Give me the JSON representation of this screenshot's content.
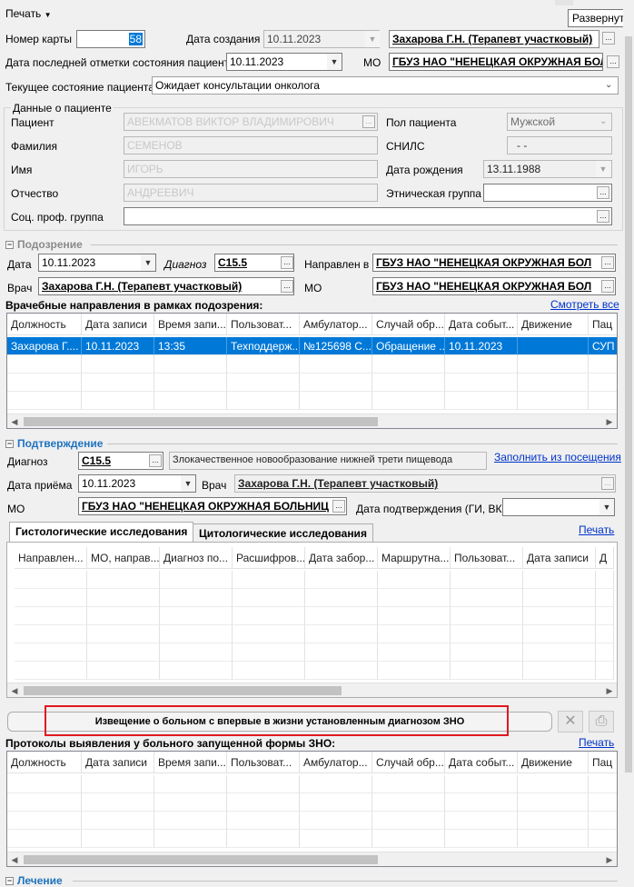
{
  "toolbar": {
    "print_menu": "Печать",
    "expand_tooltip": "Развернуть"
  },
  "header": {
    "card_number_label": "Номер карты",
    "card_number_value": "58",
    "created_label": "Дата создания",
    "created_value": "10.11.2023",
    "doctor_value": "Захарова Г.Н. (Терапевт участковый)",
    "last_mark_label": "Дата последней отметки состояния пациента",
    "last_mark_value": "10.11.2023",
    "mo_label": "МО",
    "mo_value": "ГБУЗ НАО \"НЕНЕЦКАЯ ОКРУЖНАЯ БОЛ",
    "state_label": "Текущее состояние пациента",
    "state_value": "Ожидает консультации онколога"
  },
  "patient": {
    "group_title": "Данные о пациенте",
    "patient_label": "Пациент",
    "patient_value": "АВЕКМАТОВ ВИКТОР ВЛАДИМИРОВИЧ",
    "surname_label": "Фамилия",
    "surname_value": "СЕМЕНОВ",
    "name_label": "Имя",
    "name_value": "ИГОРЬ",
    "patronymic_label": "Отчество",
    "patronymic_value": "АНДРЕЕВИЧ",
    "social_label": "Соц. проф. группа",
    "social_value": "",
    "sex_label": "Пол пациента",
    "sex_value": "Мужской",
    "snils_label": "СНИЛС",
    "snils_value": "-   -",
    "birth_label": "Дата рождения",
    "birth_value": "13.11.1988",
    "ethnic_label": "Этническая группа",
    "ethnic_value": ""
  },
  "suspicion": {
    "title": "Подозрение",
    "date_label": "Дата",
    "date_value": "10.11.2023",
    "diagnosis_label": "Диагноз",
    "diagnosis_value": "C15.5",
    "sent_to_label": "Направлен в",
    "sent_to_value": "ГБУЗ НАО \"НЕНЕЦКАЯ ОКРУЖНАЯ БОЛ",
    "doctor_label": "Врач",
    "doctor_value": "Захарова Г.Н. (Терапевт участковый)",
    "mo_label": "МО",
    "mo_value": "ГБУЗ НАО \"НЕНЕЦКАЯ ОКРУЖНАЯ БОЛ",
    "referrals_title": "Врачебные направления в рамках подозрения:",
    "view_all_link": "Смотреть все",
    "columns": [
      "Должность",
      "Дата записи",
      "Время запи...",
      "Пользоват...",
      "Амбулатор...",
      "Случай обр...",
      "Дата событ...",
      "Движение",
      "Пац"
    ],
    "rows": [
      [
        "Захарова Г....",
        "10.11.2023",
        "13:35",
        "Техподдерж...",
        "№125698 С...",
        "Обращение ...",
        "10.11.2023",
        "",
        "СУП"
      ]
    ]
  },
  "confirmation": {
    "title": "Подтверждение",
    "diagnosis_label": "Диагноз",
    "diagnosis_code": "C15.5",
    "diagnosis_text": "Злокачественное новообразование нижней трети пищевода",
    "fill_from_visit_link": "Заполнить из посещения",
    "visit_date_label": "Дата приёма",
    "visit_date_value": "10.11.2023",
    "doctor_label": "Врач",
    "doctor_value": "Захарова Г.Н. (Терапевт участковый)",
    "mo_label": "МО",
    "mo_value": "ГБУЗ НАО \"НЕНЕЦКАЯ ОКРУЖНАЯ БОЛЬНИЦ",
    "confirm_date_label": "Дата подтверждения (ГИ, ВК)",
    "confirm_date_value": "",
    "tab_histology": "Гистологические исследования",
    "tab_cytology": "Цитологические исследования",
    "print_link": "Печать",
    "columns": [
      "Направлен...",
      "МО, направ...",
      "Диагноз по...",
      "Расшифров...",
      "Дата забор...",
      "Маршрутна...",
      "Пользоват...",
      "Дата записи",
      "Д"
    ]
  },
  "notice_button": "Извещение о больном с впервые в жизни установленным диагнозом ЗНО",
  "protocols": {
    "title": "Протоколы выявления у больного запущенной формы ЗНО:",
    "print_link": "Печать",
    "columns": [
      "Должность",
      "Дата записи",
      "Время запи...",
      "Пользоват...",
      "Амбулатор...",
      "Случай обр...",
      "Дата событ...",
      "Движение",
      "Пац"
    ]
  },
  "bottom_section": {
    "title": "Лечение"
  }
}
